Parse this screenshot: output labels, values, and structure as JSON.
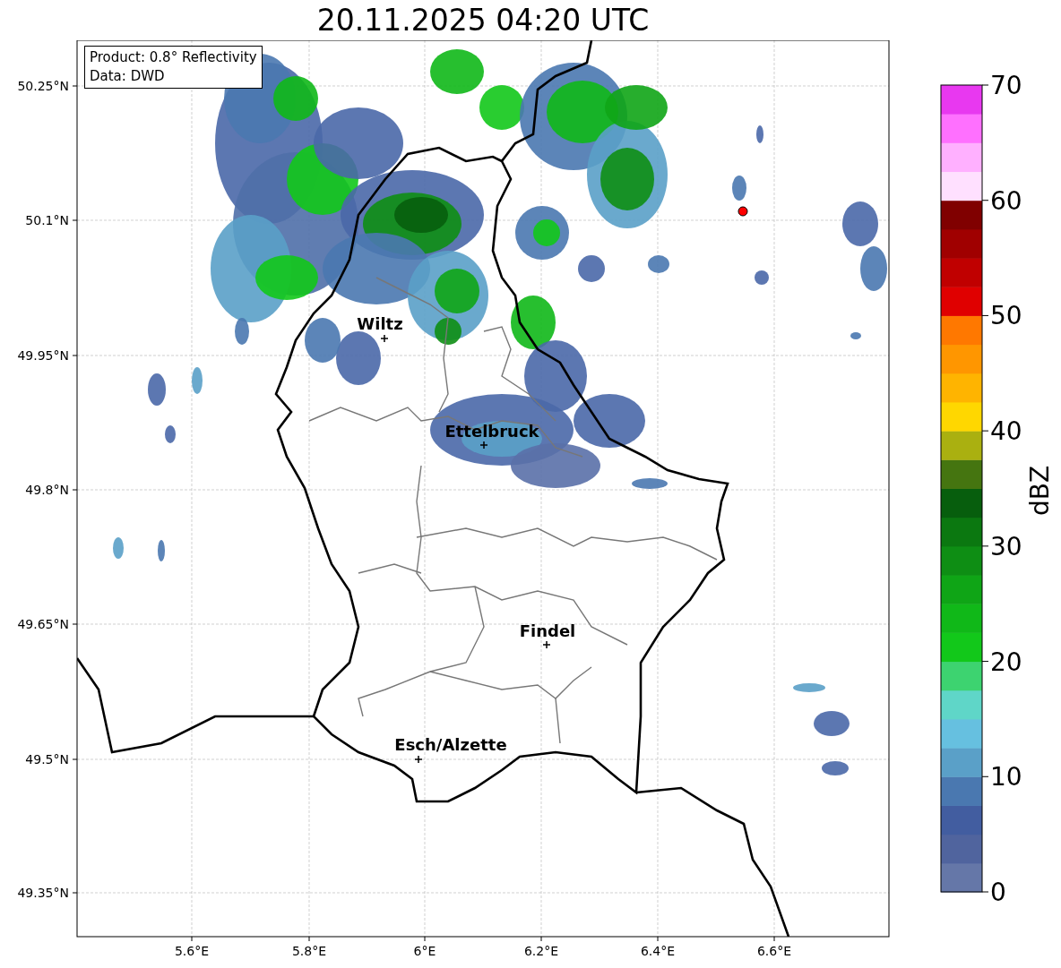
{
  "title": "20.11.2025 04:20 UTC",
  "info_box": [
    "Product: 0.8° Reflectivity",
    "Data: DWD"
  ],
  "y_ticks": [
    "50.25°N",
    "50.1°N",
    "49.95°N",
    "49.8°N",
    "49.65°N",
    "49.5°N",
    "49.35°N"
  ],
  "x_ticks": [
    "5.6°E",
    "5.8°E",
    "6°E",
    "6.2°E",
    "6.4°E",
    "6.6°E"
  ],
  "cities": [
    {
      "name": "Wiltz"
    },
    {
      "name": "Ettelbruck"
    },
    {
      "name": "Findel"
    },
    {
      "name": "Esch/Alzette"
    }
  ],
  "colorbar": {
    "label": "dBZ",
    "ticks": [
      "70",
      "60",
      "50",
      "40",
      "30",
      "20",
      "10",
      "0"
    ]
  }
}
